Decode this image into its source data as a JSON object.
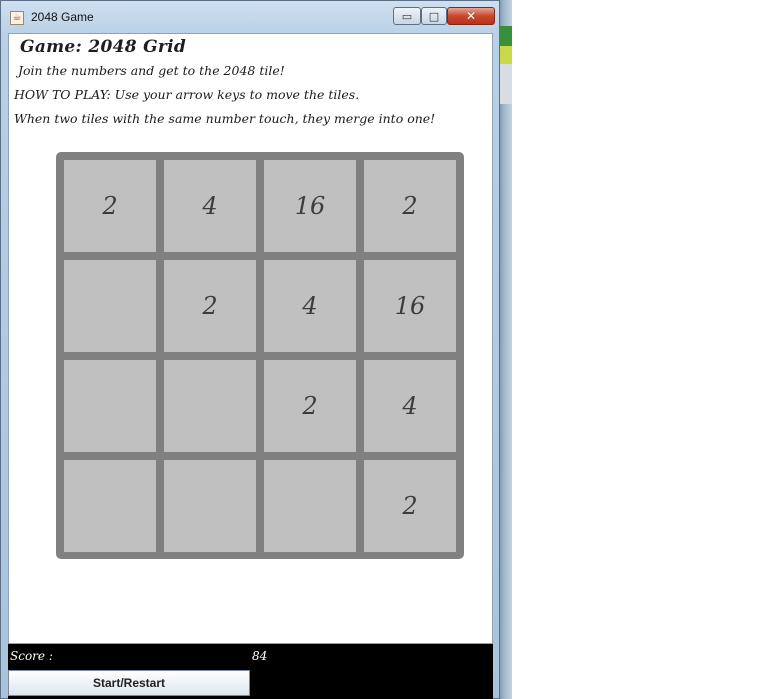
{
  "window": {
    "title": "2048 Game",
    "icon": "java-coffee-cup-icon",
    "controls": {
      "minimize": "▭",
      "maximize": "□",
      "close": "✕"
    }
  },
  "game": {
    "title": "Game: 2048 Grid",
    "intro_line1": "Join the numbers and get to the 2048 tile!",
    "intro_line2": "HOW TO PLAY: Use your arrow keys to move the tiles.",
    "intro_line3": "When two tiles with the same number touch, they merge into one!"
  },
  "board": {
    "rows": [
      [
        "2",
        "4",
        "16",
        "2"
      ],
      [
        "",
        "2",
        "4",
        "16"
      ],
      [
        "",
        "",
        "2",
        "4"
      ],
      [
        "",
        "",
        "",
        "2"
      ]
    ]
  },
  "status": {
    "score_label": "Score :",
    "score_value": "84",
    "restart_label": "Start/Restart"
  },
  "colors": {
    "board": "#808080",
    "tile": "#c0c0c0",
    "tile_text": "#3c3c3c",
    "status_bar": "#000000"
  }
}
